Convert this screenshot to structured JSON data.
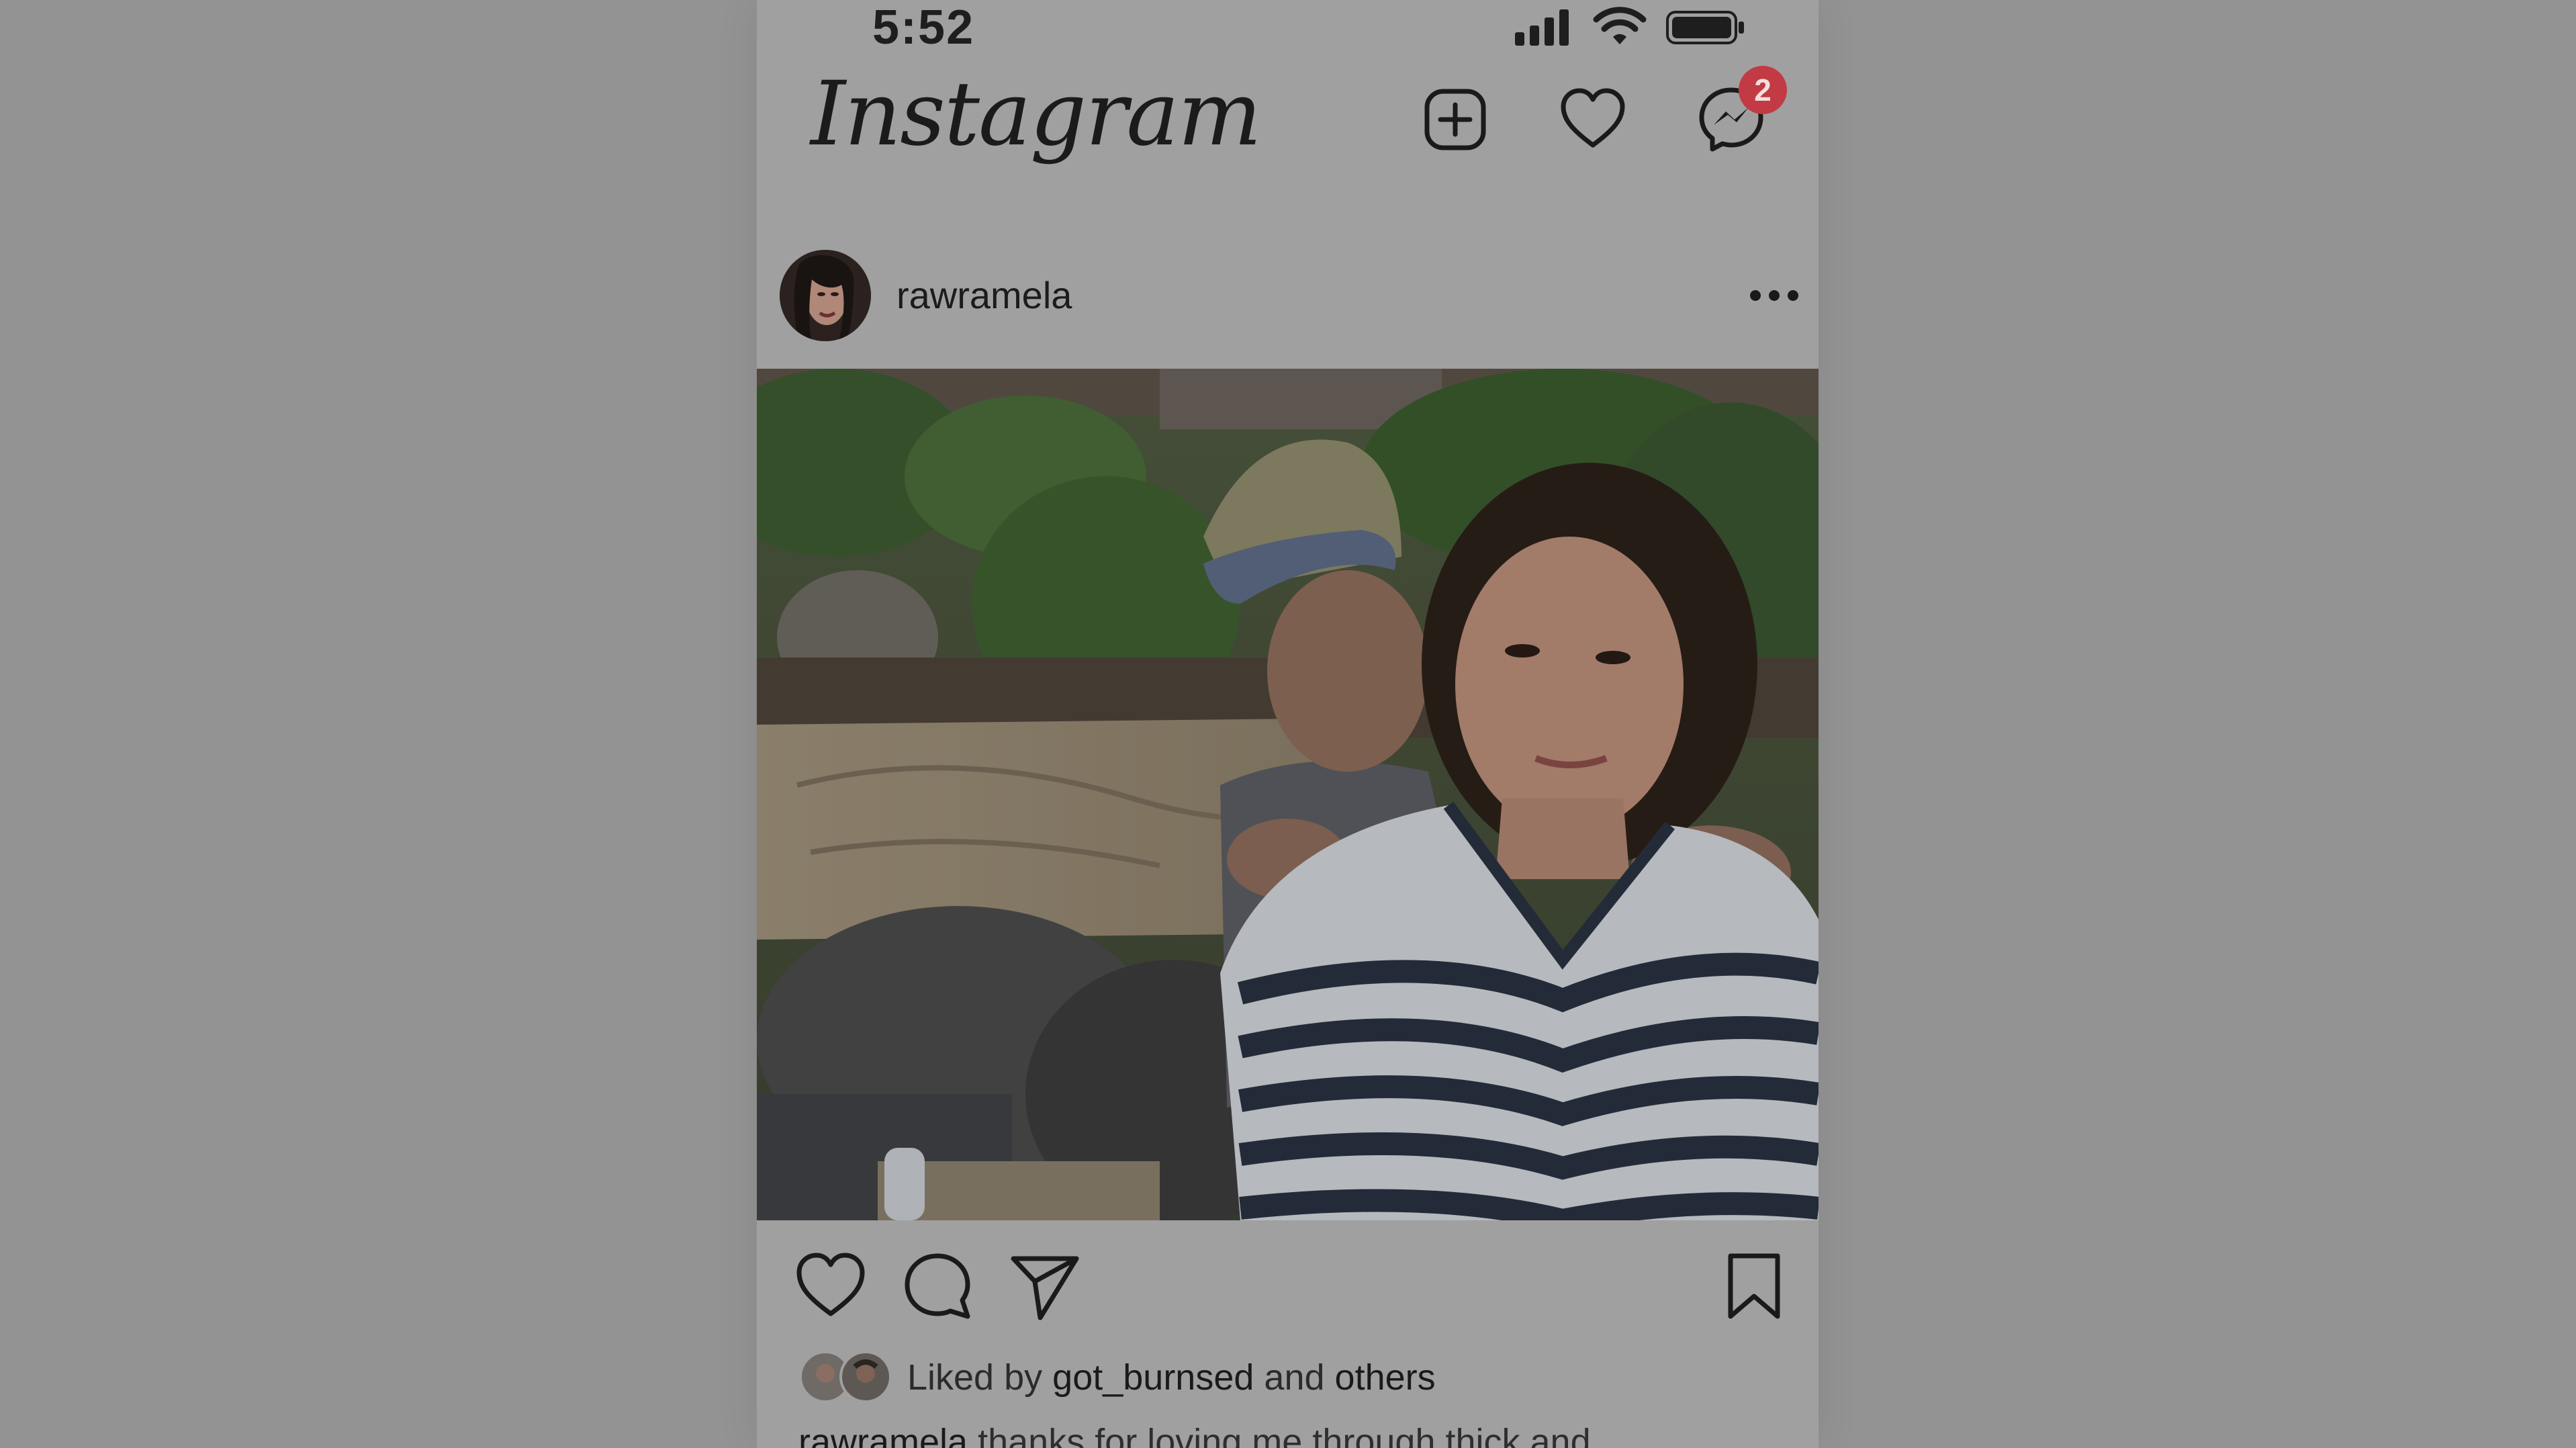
{
  "status_bar": {
    "time": "5:52",
    "icons": [
      "cellular-signal-icon",
      "wifi-icon",
      "battery-icon"
    ]
  },
  "header": {
    "logo_text": "Instagram",
    "icons": [
      "new-post-icon",
      "activity-heart-icon",
      "messenger-icon"
    ],
    "messenger_badge": "2",
    "badge_color": "#c23a44"
  },
  "post": {
    "username": "rawramela",
    "more_icon": "more-options-icon",
    "actions": [
      "like-icon",
      "comment-icon",
      "share-icon",
      "save-icon"
    ],
    "likes": {
      "prefix": "Liked by",
      "user": "got_burnsed",
      "conjunction": "and",
      "others": "others"
    },
    "caption": {
      "username": "rawramela",
      "text": "thanks for loving me through thick and"
    }
  }
}
